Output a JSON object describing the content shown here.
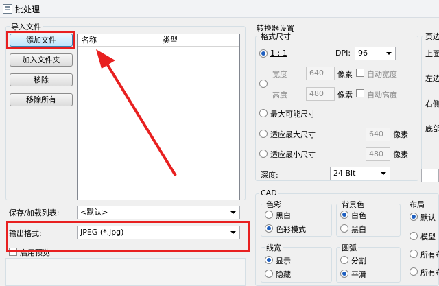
{
  "window": {
    "title": "批处理"
  },
  "import": {
    "group_label": "导入文件",
    "add_file": "添加文件",
    "add_folder": "加入文件夹",
    "remove": "移除",
    "remove_all": "移除所有",
    "columns": [
      "名称",
      "类型"
    ]
  },
  "preset": {
    "label": "保存/加载列表:",
    "value": "<默认>"
  },
  "output": {
    "label": "输出格式:",
    "value": "JPEG (*.jpg)",
    "preview": "启用预览"
  },
  "converter": {
    "group_label": "转换器设置",
    "format_label": "格式尺寸",
    "ratio": "1 : 1",
    "dpi_label": "DPI:",
    "dpi_value": "96",
    "width_label": "宽度",
    "width_value": "640",
    "height_label": "高度",
    "height_value": "480",
    "pixels": "像素",
    "auto_width": "自动宽度",
    "auto_height": "自动高度",
    "max_possible": "最大可能尺寸",
    "fit_max": "适应最大尺寸",
    "fit_max_value": "640",
    "fit_min": "适应最小尺寸",
    "fit_min_value": "480",
    "depth_label": "深度:",
    "depth_value": "24 Bit"
  },
  "cad": {
    "group_label": "CAD",
    "color_label": "色彩",
    "bw": "黑白",
    "color_mode": "色彩模式",
    "bg_label": "背景色",
    "white": "白色",
    "black": "黑白",
    "line_label": "线宽",
    "show": "显示",
    "hide": "隐藏",
    "arc_label": "圆弧",
    "segment": "分割",
    "smooth": "平滑",
    "layout_label": "布局",
    "default": "默认",
    "model": "模型",
    "all1": "所有布",
    "all2": "所有布"
  },
  "margins": {
    "label": "页边",
    "top": "上面",
    "left": "左边",
    "right": "右侧",
    "bottom": "底部"
  },
  "colors": {
    "highlight": "#e82020",
    "radio_dot": "#1f5fbf"
  }
}
